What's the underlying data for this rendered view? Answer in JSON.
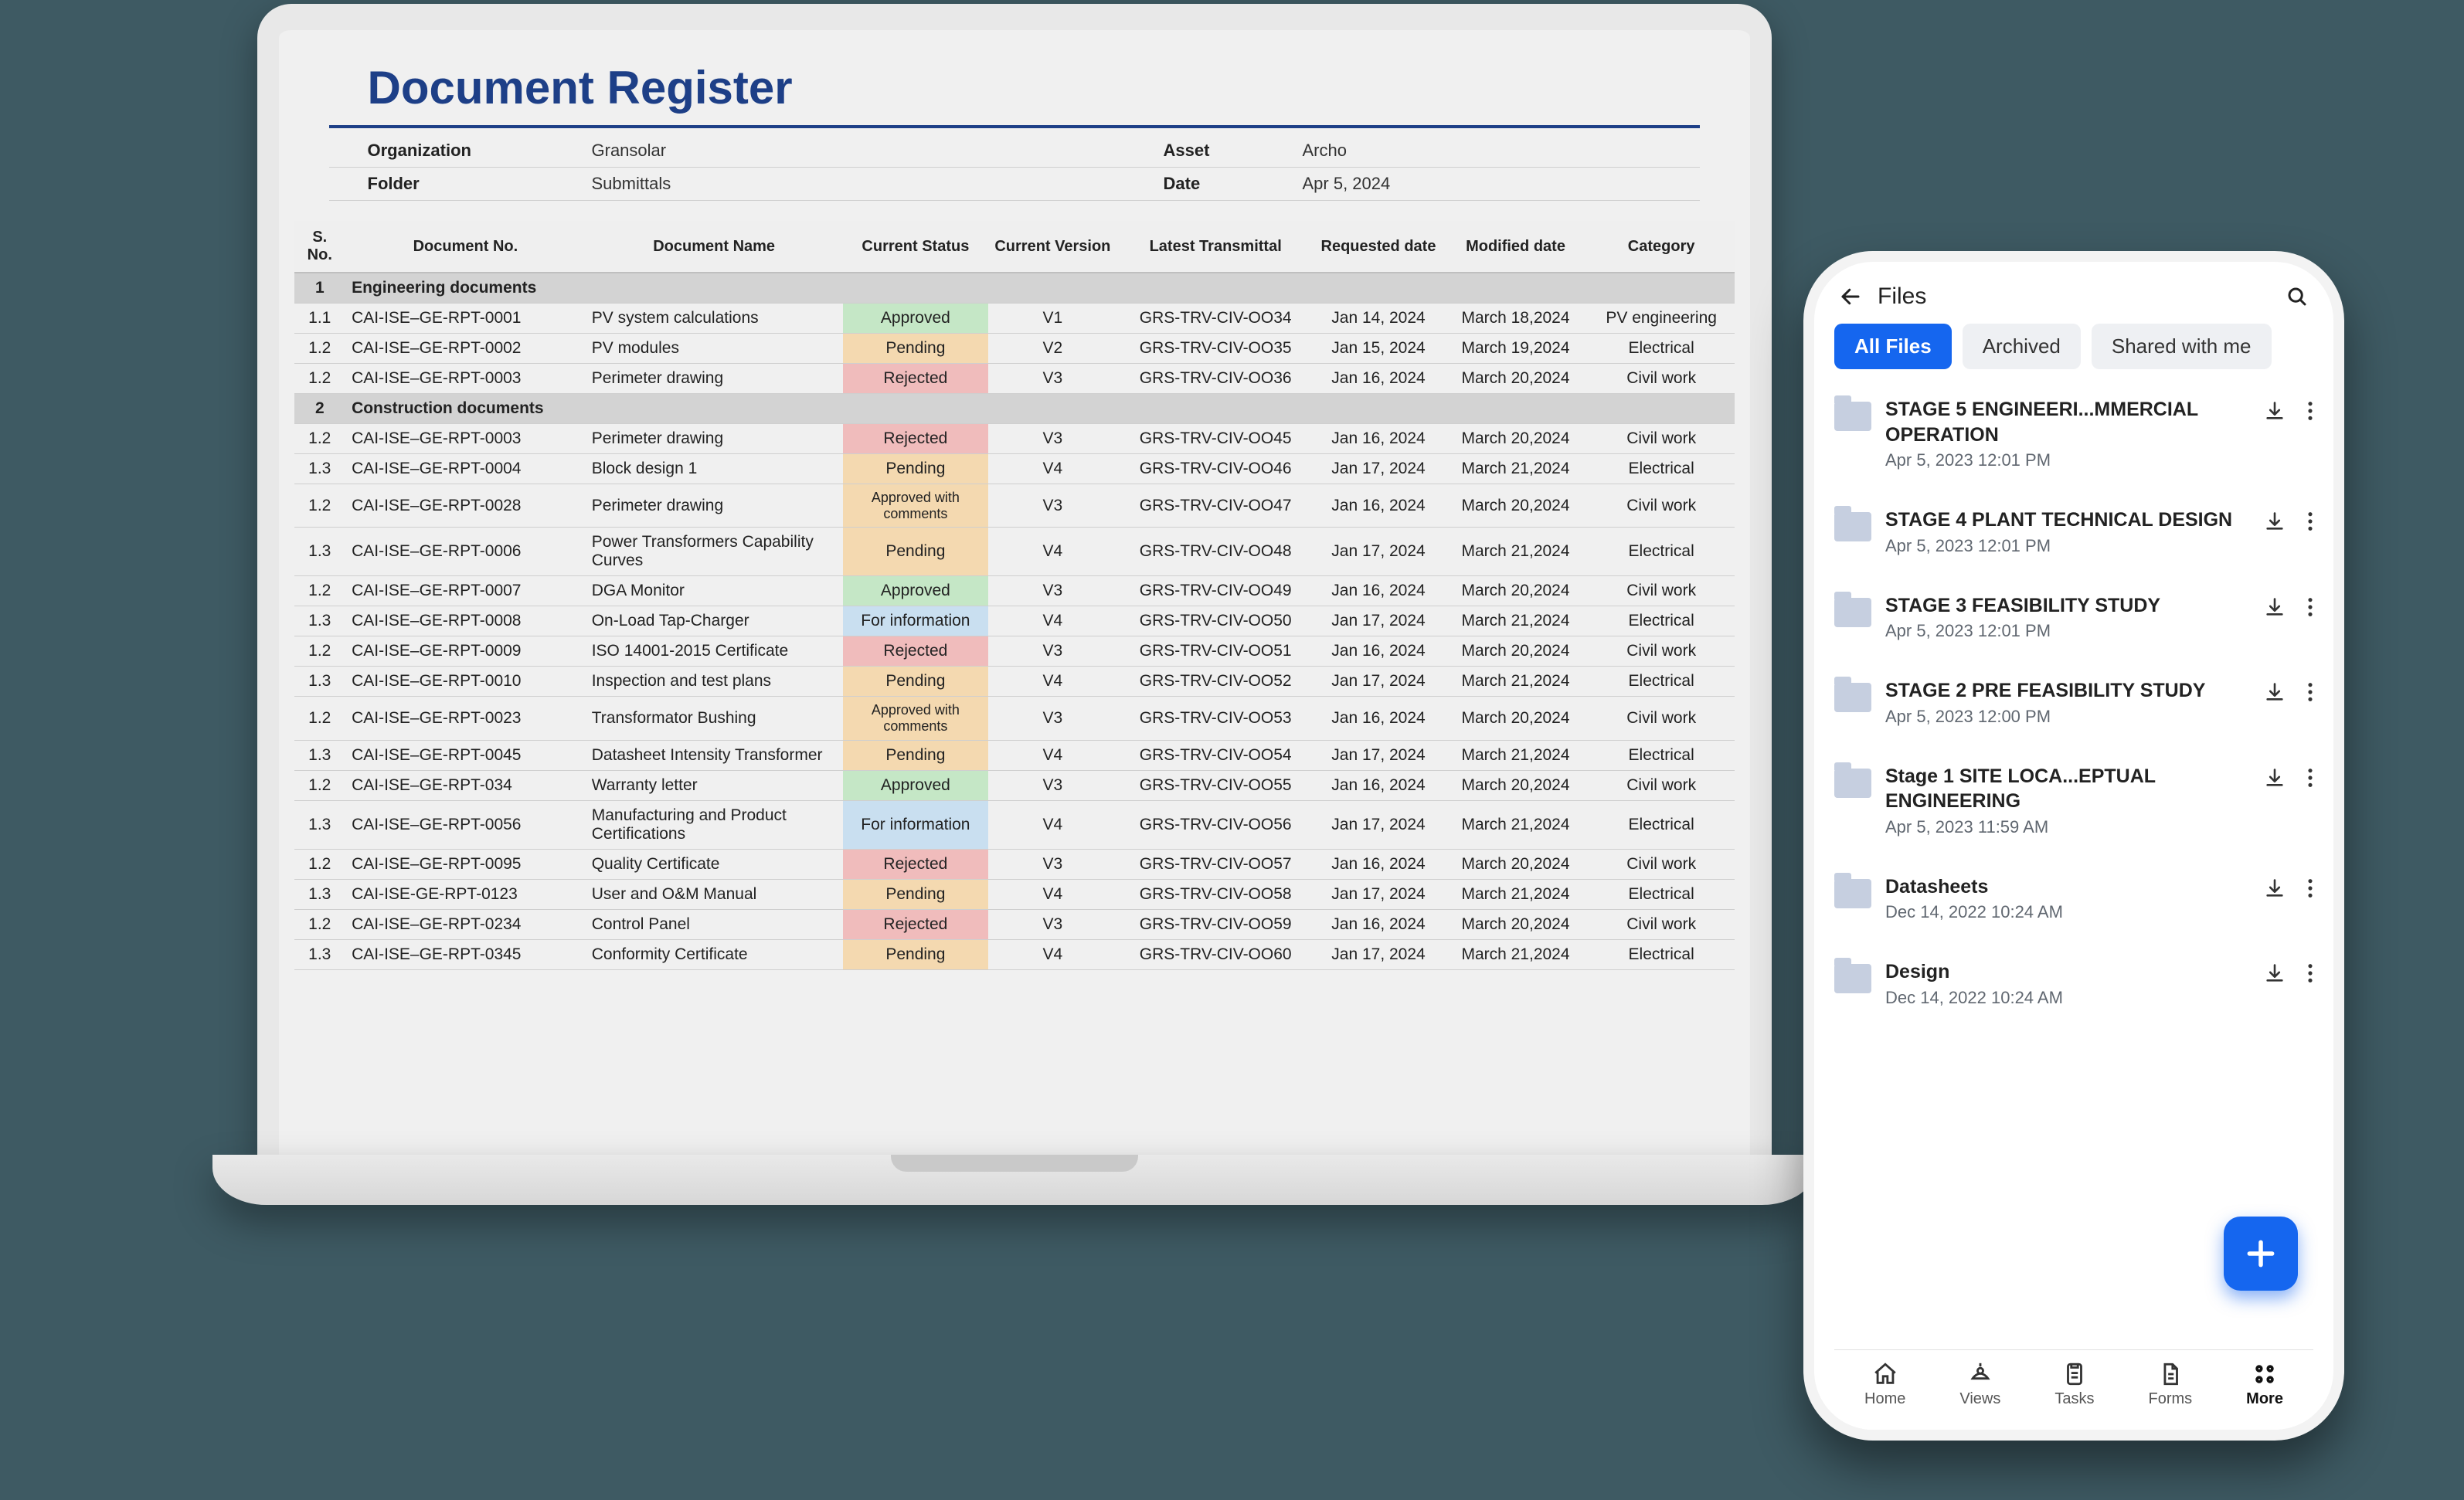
{
  "laptop": {
    "title": "Document Register",
    "meta": {
      "org_label": "Organization",
      "org_value": "Gransolar",
      "asset_label": "Asset",
      "asset_value": "Archo",
      "folder_label": "Folder",
      "folder_value": "Submittals",
      "date_label": "Date",
      "date_value": "Apr 5, 2024"
    },
    "columns": {
      "sno": "S. No.",
      "docno": "Document No.",
      "name": "Document Name",
      "status": "Current Status",
      "version": "Current Version",
      "transmittal": "Latest Transmittal",
      "requested": "Requested date",
      "modified": "Modified date",
      "category": "Category"
    },
    "sections": [
      {
        "num": "1",
        "title": "Engineering documents",
        "rows": [
          {
            "sno": "1.1",
            "doc": "CAI-ISE–GE-RPT-0001",
            "name": "PV system calculations",
            "status": "Approved",
            "status_class": "approved",
            "ver": "V1",
            "trans": "GRS-TRV-CIV-OO34",
            "req": "Jan 14, 2024",
            "mod": "March 18,2024",
            "cat": "PV engineering"
          },
          {
            "sno": "1.2",
            "doc": "CAI-ISE–GE-RPT-0002",
            "name": "PV modules",
            "status": "Pending",
            "status_class": "pending",
            "ver": "V2",
            "trans": "GRS-TRV-CIV-OO35",
            "req": "Jan 15, 2024",
            "mod": "March 19,2024",
            "cat": "Electrical"
          },
          {
            "sno": "1.2",
            "doc": "CAI-ISE–GE-RPT-0003",
            "name": "Perimeter drawing",
            "status": "Rejected",
            "status_class": "rejected",
            "ver": "V3",
            "trans": "GRS-TRV-CIV-OO36",
            "req": "Jan 16, 2024",
            "mod": "March 20,2024",
            "cat": "Civil work"
          }
        ]
      },
      {
        "num": "2",
        "title": "Construction documents",
        "rows": [
          {
            "sno": "1.2",
            "doc": "CAI-ISE–GE-RPT-0003",
            "name": "Perimeter drawing",
            "status": "Rejected",
            "status_class": "rejected",
            "ver": "V3",
            "trans": "GRS-TRV-CIV-OO45",
            "req": "Jan 16, 2024",
            "mod": "March 20,2024",
            "cat": "Civil work"
          },
          {
            "sno": "1.3",
            "doc": "CAI-ISE–GE-RPT-0004",
            "name": "Block design 1",
            "status": "Pending",
            "status_class": "pending",
            "ver": "V4",
            "trans": "GRS-TRV-CIV-OO46",
            "req": "Jan 17, 2024",
            "mod": "March 21,2024",
            "cat": "Electrical"
          },
          {
            "sno": "1.2",
            "doc": "CAI-ISE–GE-RPT-0028",
            "name": "Perimeter drawing",
            "status": "Approved with comments",
            "status_class": "approved-comments",
            "ver": "V3",
            "trans": "GRS-TRV-CIV-OO47",
            "req": "Jan 16, 2024",
            "mod": "March 20,2024",
            "cat": "Civil work"
          },
          {
            "sno": "1.3",
            "doc": "CAI-ISE–GE-RPT-0006",
            "name": "Power Transformers Capability Curves",
            "status": "Pending",
            "status_class": "pending",
            "ver": "V4",
            "trans": "GRS-TRV-CIV-OO48",
            "req": "Jan 17, 2024",
            "mod": "March 21,2024",
            "cat": "Electrical"
          },
          {
            "sno": "1.2",
            "doc": "CAI-ISE–GE-RPT-0007",
            "name": "DGA Monitor",
            "status": "Approved",
            "status_class": "approved",
            "ver": "V3",
            "trans": "GRS-TRV-CIV-OO49",
            "req": "Jan 16, 2024",
            "mod": "March 20,2024",
            "cat": "Civil work"
          },
          {
            "sno": "1.3",
            "doc": "CAI-ISE–GE-RPT-0008",
            "name": "On-Load Tap-Charger",
            "status": "For information",
            "status_class": "for-information",
            "ver": "V4",
            "trans": "GRS-TRV-CIV-OO50",
            "req": "Jan 17, 2024",
            "mod": "March 21,2024",
            "cat": "Electrical"
          },
          {
            "sno": "1.2",
            "doc": "CAI-ISE–GE-RPT-0009",
            "name": "ISO 14001-2015 Certificate",
            "status": "Rejected",
            "status_class": "rejected",
            "ver": "V3",
            "trans": "GRS-TRV-CIV-OO51",
            "req": "Jan 16, 2024",
            "mod": "March 20,2024",
            "cat": "Civil work"
          },
          {
            "sno": "1.3",
            "doc": "CAI-ISE–GE-RPT-0010",
            "name": "Inspection and test plans",
            "status": "Pending",
            "status_class": "pending",
            "ver": "V4",
            "trans": "GRS-TRV-CIV-OO52",
            "req": "Jan 17, 2024",
            "mod": "March 21,2024",
            "cat": "Electrical"
          },
          {
            "sno": "1.2",
            "doc": "CAI-ISE–GE-RPT-0023",
            "name": "Transformator Bushing",
            "status": "Approved with comments",
            "status_class": "approved-comments",
            "ver": "V3",
            "trans": "GRS-TRV-CIV-OO53",
            "req": "Jan 16, 2024",
            "mod": "March 20,2024",
            "cat": "Civil work"
          },
          {
            "sno": "1.3",
            "doc": "CAI-ISE–GE-RPT-0045",
            "name": "Datasheet Intensity Transformer",
            "status": "Pending",
            "status_class": "pending",
            "ver": "V4",
            "trans": "GRS-TRV-CIV-OO54",
            "req": "Jan 17, 2024",
            "mod": "March 21,2024",
            "cat": "Electrical"
          },
          {
            "sno": "1.2",
            "doc": "CAI-ISE–GE-RPT-034",
            "name": "Warranty letter",
            "status": "Approved",
            "status_class": "approved",
            "ver": "V3",
            "trans": "GRS-TRV-CIV-OO55",
            "req": "Jan 16, 2024",
            "mod": "March 20,2024",
            "cat": "Civil work"
          },
          {
            "sno": "1.3",
            "doc": "CAI-ISE–GE-RPT-0056",
            "name": "Manufacturing and Product Certifications",
            "status": "For information",
            "status_class": "for-information",
            "ver": "V4",
            "trans": "GRS-TRV-CIV-OO56",
            "req": "Jan 17, 2024",
            "mod": "March 21,2024",
            "cat": "Electrical"
          },
          {
            "sno": "1.2",
            "doc": "CAI-ISE–GE-RPT-0095",
            "name": "Quality Certificate",
            "status": "Rejected",
            "status_class": "rejected",
            "ver": "V3",
            "trans": "GRS-TRV-CIV-OO57",
            "req": "Jan 16, 2024",
            "mod": "March 20,2024",
            "cat": "Civil work"
          },
          {
            "sno": "1.3",
            "doc": "CAI-ISE-GE-RPT-0123",
            "name": "User and O&M Manual",
            "status": "Pending",
            "status_class": "pending",
            "ver": "V4",
            "trans": "GRS-TRV-CIV-OO58",
            "req": "Jan 17, 2024",
            "mod": "March 21,2024",
            "cat": "Electrical"
          },
          {
            "sno": "1.2",
            "doc": "CAI-ISE–GE-RPT-0234",
            "name": "Control Panel",
            "status": "Rejected",
            "status_class": "rejected",
            "ver": "V3",
            "trans": "GRS-TRV-CIV-OO59",
            "req": "Jan 16, 2024",
            "mod": "March 20,2024",
            "cat": "Civil work"
          },
          {
            "sno": "1.3",
            "doc": "CAI-ISE–GE-RPT-0345",
            "name": "Conformity Certificate",
            "status": "Pending",
            "status_class": "pending",
            "ver": "V4",
            "trans": "GRS-TRV-CIV-OO60",
            "req": "Jan 17, 2024",
            "mod": "March 21,2024",
            "cat": "Electrical"
          }
        ]
      }
    ]
  },
  "phone": {
    "header_title": "Files",
    "tabs": [
      {
        "label": "All Files",
        "active": true
      },
      {
        "label": "Archived",
        "active": false
      },
      {
        "label": "Shared with me",
        "active": false
      }
    ],
    "files": [
      {
        "name": "STAGE 5 ENGINEERI...MMERCIAL OPERATION",
        "date": "Apr 5, 2023 12:01 PM"
      },
      {
        "name": "STAGE 4 PLANT TECHNICAL DESIGN",
        "date": "Apr 5, 2023 12:01 PM"
      },
      {
        "name": "STAGE 3 FEASIBILITY STUDY",
        "date": "Apr 5, 2023 12:01 PM"
      },
      {
        "name": "STAGE 2 PRE FEASIBILITY STUDY",
        "date": "Apr 5, 2023 12:00 PM"
      },
      {
        "name": "Stage 1 SITE LOCA...EPTUAL ENGINEERING",
        "date": "Apr 5, 2023 11:59 AM"
      },
      {
        "name": "Datasheets",
        "date": "Dec 14, 2022 10:24 AM"
      },
      {
        "name": "Design",
        "date": "Dec 14, 2022 10:24 AM"
      }
    ],
    "nav": {
      "home": "Home",
      "views": "Views",
      "tasks": "Tasks",
      "forms": "Forms",
      "more": "More"
    }
  }
}
